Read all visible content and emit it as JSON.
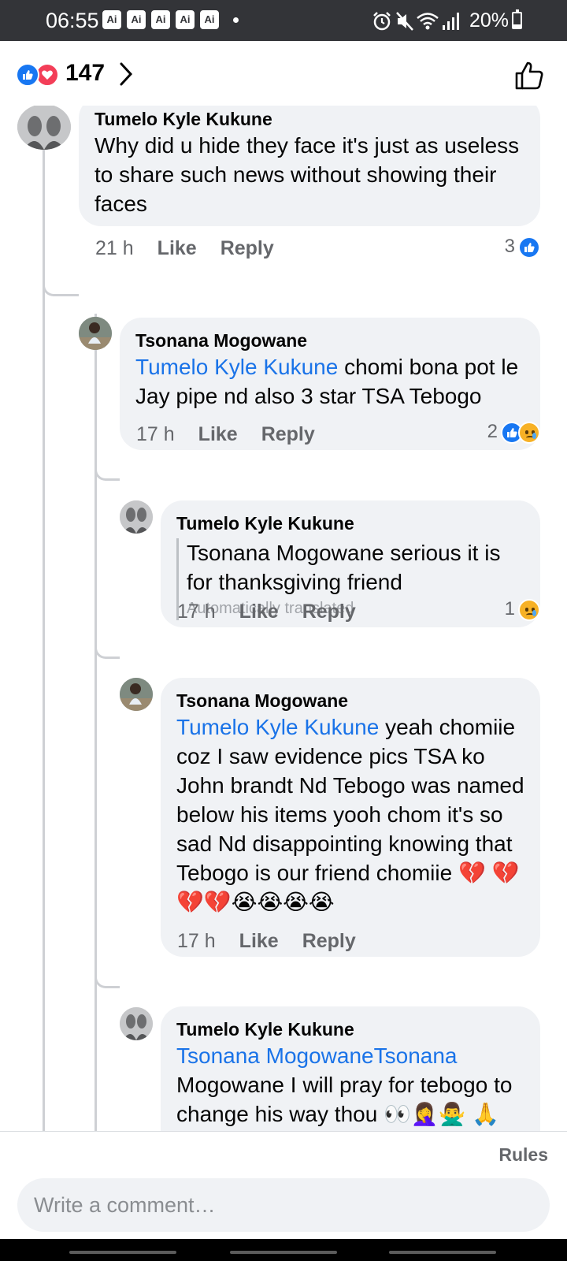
{
  "status_bar": {
    "time": "06:55",
    "ai_badges": [
      "Ai",
      "Ai",
      "Ai",
      "Ai",
      "Ai"
    ],
    "battery": "20%",
    "battery_level": 0.2,
    "icons": [
      "alarm-icon",
      "mute-icon",
      "wifi-icon",
      "signal-icon",
      "battery-icon"
    ]
  },
  "header": {
    "reaction_count": "147",
    "reactions": [
      "like-reaction-icon",
      "love-reaction-icon"
    ]
  },
  "comments": [
    {
      "author": "Tumelo Kyle Kukune",
      "text": "Why did u hide they face it's just as useless to share such news without showing their faces",
      "time": "21 h",
      "like_label": "Like",
      "reply_label": "Reply",
      "reaction_count": "3",
      "reactions": [
        "like"
      ]
    },
    {
      "author": "Tsonana Mogowane",
      "mention": "Tumelo Kyle Kukune",
      "text": " chomi bona pot le Jay pipe nd also 3 star TSA Tebogo",
      "time": "17 h",
      "like_label": "Like",
      "reply_label": "Reply",
      "reaction_count": "2",
      "reactions": [
        "like",
        "sad"
      ]
    },
    {
      "author": "Tumelo Kyle Kukune",
      "text": "Tsonana Mogowane serious it is for thanksgiving friend",
      "translated_note": "Automatically translated",
      "time": "17 h",
      "like_label": "Like",
      "reply_label": "Reply",
      "reaction_count": "1",
      "reactions": [
        "sad"
      ]
    },
    {
      "author": "Tsonana Mogowane",
      "mention": "Tumelo Kyle Kukune",
      "text": " yeah chomiie coz I saw evidence pics TSA ko John brandt Nd Tebogo was named below his items yooh chom it's so sad Nd disappointing knowing that Tebogo is our friend chomiie 💔 💔💔💔😭😭😭😭",
      "time": "17 h",
      "like_label": "Like",
      "reply_label": "Reply"
    },
    {
      "author": "Tumelo Kyle Kukune",
      "mention": "Tsonana MogowaneTsonana",
      "text": " Mogowane I will pray for tebogo to change his way thou 👀🤦‍♀️🙅‍♂️ 🙏😭"
    }
  ],
  "footer": {
    "rules_label": "Rules",
    "comment_placeholder": "Write a comment…"
  }
}
